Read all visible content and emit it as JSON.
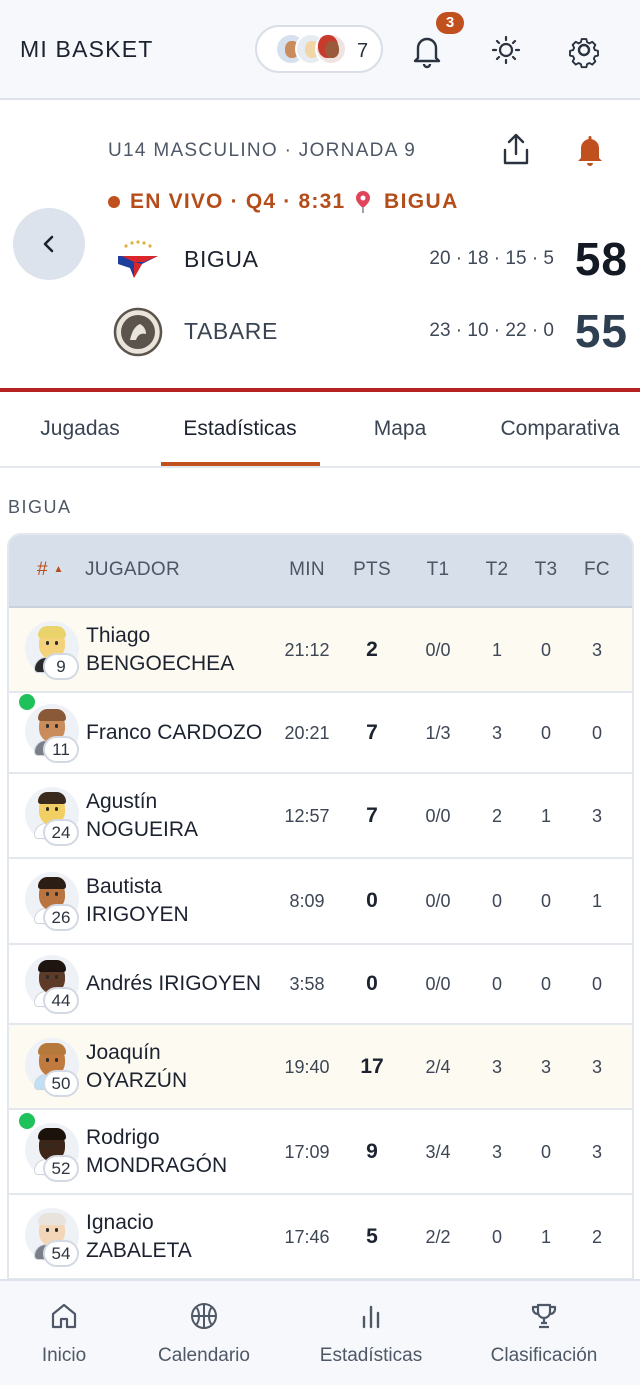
{
  "app": {
    "title": "MI BASKET"
  },
  "header": {
    "followers_count": "7",
    "notifications_badge": "3"
  },
  "game": {
    "league": "U14 MASCULINO · JORNADA 9",
    "status": "EN VIVO · Q4 · 8:31",
    "venue": "BIGUA",
    "home": {
      "name": "BIGUA",
      "quarters": "20 · 18 · 15 · 5",
      "score": "58"
    },
    "away": {
      "name": "TABARE",
      "quarters": "23 · 10 · 22 · 0",
      "score": "55"
    }
  },
  "tabs": [
    "Jugadas",
    "Estadísticas",
    "Mapa",
    "Comparativa"
  ],
  "active_tab": "Estadísticas",
  "section_label": "BIGUA",
  "table": {
    "headers": {
      "num": "#",
      "player": "JUGADOR",
      "min": "MIN",
      "pts": "PTS",
      "t1": "T1",
      "t2": "T2",
      "t3": "T3",
      "fc": "FC"
    },
    "sort_indicator": "▲",
    "rows": [
      {
        "number": "9",
        "name_line1": "Thiago",
        "name_line2": "BENGOECHEA",
        "min": "21:12",
        "pts": "2",
        "t1": "0/0",
        "t2": "1",
        "t3": "0",
        "fc": "3",
        "on_court": false,
        "highlight": true
      },
      {
        "number": "11",
        "name_line1": "Franco CARDOZO",
        "name_line2": "",
        "min": "20:21",
        "pts": "7",
        "t1": "1/3",
        "t2": "3",
        "t3": "0",
        "fc": "0",
        "on_court": true,
        "highlight": false
      },
      {
        "number": "24",
        "name_line1": "Agustín",
        "name_line2": "NOGUEIRA",
        "min": "12:57",
        "pts": "7",
        "t1": "0/0",
        "t2": "2",
        "t3": "1",
        "fc": "3",
        "on_court": false,
        "highlight": false
      },
      {
        "number": "26",
        "name_line1": "Bautista",
        "name_line2": "IRIGOYEN",
        "min": "8:09",
        "pts": "0",
        "t1": "0/0",
        "t2": "0",
        "t3": "0",
        "fc": "1",
        "on_court": false,
        "highlight": false
      },
      {
        "number": "44",
        "name_line1": "Andrés IRIGOYEN",
        "name_line2": "",
        "min": "3:58",
        "pts": "0",
        "t1": "0/0",
        "t2": "0",
        "t3": "0",
        "fc": "0",
        "on_court": false,
        "highlight": false
      },
      {
        "number": "50",
        "name_line1": "Joaquín",
        "name_line2": "OYARZÚN",
        "min": "19:40",
        "pts": "17",
        "t1": "2/4",
        "t2": "3",
        "t3": "3",
        "fc": "3",
        "on_court": false,
        "highlight": true
      },
      {
        "number": "52",
        "name_line1": "Rodrigo",
        "name_line2": "MONDRAGÓN",
        "min": "17:09",
        "pts": "9",
        "t1": "3/4",
        "t2": "3",
        "t3": "0",
        "fc": "3",
        "on_court": true,
        "highlight": false
      },
      {
        "number": "54",
        "name_line1": "Ignacio",
        "name_line2": "ZABALETA",
        "min": "17:46",
        "pts": "5",
        "t1": "2/2",
        "t2": "0",
        "t3": "1",
        "fc": "2",
        "on_court": false,
        "highlight": false
      }
    ]
  },
  "bottom_nav": [
    {
      "label": "Inicio",
      "icon": "home-icon"
    },
    {
      "label": "Calendario",
      "icon": "basketball-icon"
    },
    {
      "label": "Estadísticas",
      "icon": "bar-chart-icon"
    },
    {
      "label": "Clasificación",
      "icon": "trophy-icon"
    }
  ],
  "colors": {
    "accent": "#c0511f",
    "live": "#b54d1a",
    "divider": "#b5221f",
    "on_court": "#1ec15a",
    "highlight_row": "#fcfaf1"
  }
}
